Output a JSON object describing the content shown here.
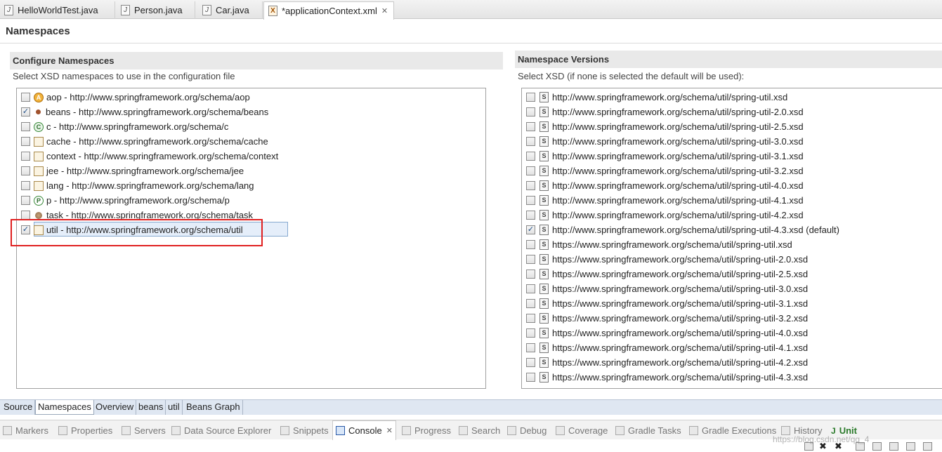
{
  "editor_tabs": [
    {
      "label": "HelloWorldTest.java",
      "icon": "java-file-icon"
    },
    {
      "label": "Person.java",
      "icon": "java-file-icon"
    },
    {
      "label": "Car.java",
      "icon": "java-file-icon"
    },
    {
      "label": "*applicationContext.xml",
      "icon": "xml-file-icon",
      "active": true
    }
  ],
  "page_title": "Namespaces",
  "configure": {
    "heading": "Configure Namespaces",
    "description": "Select XSD namespaces to use in the configuration file",
    "items": [
      {
        "label": "aop - http://www.springframework.org/schema/aop",
        "checked": false,
        "icon": "aop-icon"
      },
      {
        "label": "beans - http://www.springframework.org/schema/beans",
        "checked": true,
        "icon": "bean-icon"
      },
      {
        "label": "c - http://www.springframework.org/schema/c",
        "checked": false,
        "icon": "c-icon"
      },
      {
        "label": "cache - http://www.springframework.org/schema/cache",
        "checked": false,
        "icon": "namespace-doc-icon"
      },
      {
        "label": "context - http://www.springframework.org/schema/context",
        "checked": false,
        "icon": "namespace-doc-icon"
      },
      {
        "label": "jee - http://www.springframework.org/schema/jee",
        "checked": false,
        "icon": "namespace-doc-icon"
      },
      {
        "label": "lang - http://www.springframework.org/schema/lang",
        "checked": false,
        "icon": "namespace-doc-icon"
      },
      {
        "label": "p - http://www.springframework.org/schema/p",
        "checked": false,
        "icon": "p-icon"
      },
      {
        "label": "task - http://www.springframework.org/schema/task",
        "checked": false,
        "icon": "task-icon"
      },
      {
        "label": "util - http://www.springframework.org/schema/util",
        "checked": true,
        "icon": "namespace-doc-icon",
        "selected": true
      }
    ]
  },
  "versions": {
    "heading": "Namespace Versions",
    "description": "Select XSD (if none is selected the default will be used):",
    "items": [
      {
        "label": "http://www.springframework.org/schema/util/spring-util.xsd",
        "checked": false
      },
      {
        "label": "http://www.springframework.org/schema/util/spring-util-2.0.xsd",
        "checked": false
      },
      {
        "label": "http://www.springframework.org/schema/util/spring-util-2.5.xsd",
        "checked": false
      },
      {
        "label": "http://www.springframework.org/schema/util/spring-util-3.0.xsd",
        "checked": false
      },
      {
        "label": "http://www.springframework.org/schema/util/spring-util-3.1.xsd",
        "checked": false
      },
      {
        "label": "http://www.springframework.org/schema/util/spring-util-3.2.xsd",
        "checked": false
      },
      {
        "label": "http://www.springframework.org/schema/util/spring-util-4.0.xsd",
        "checked": false
      },
      {
        "label": "http://www.springframework.org/schema/util/spring-util-4.1.xsd",
        "checked": false
      },
      {
        "label": "http://www.springframework.org/schema/util/spring-util-4.2.xsd",
        "checked": false
      },
      {
        "label": "http://www.springframework.org/schema/util/spring-util-4.3.xsd (default)",
        "checked": true
      },
      {
        "label": "https://www.springframework.org/schema/util/spring-util.xsd",
        "checked": false
      },
      {
        "label": "https://www.springframework.org/schema/util/spring-util-2.0.xsd",
        "checked": false
      },
      {
        "label": "https://www.springframework.org/schema/util/spring-util-2.5.xsd",
        "checked": false
      },
      {
        "label": "https://www.springframework.org/schema/util/spring-util-3.0.xsd",
        "checked": false
      },
      {
        "label": "https://www.springframework.org/schema/util/spring-util-3.1.xsd",
        "checked": false
      },
      {
        "label": "https://www.springframework.org/schema/util/spring-util-3.2.xsd",
        "checked": false
      },
      {
        "label": "https://www.springframework.org/schema/util/spring-util-4.0.xsd",
        "checked": false
      },
      {
        "label": "https://www.springframework.org/schema/util/spring-util-4.1.xsd",
        "checked": false
      },
      {
        "label": "https://www.springframework.org/schema/util/spring-util-4.2.xsd",
        "checked": false
      },
      {
        "label": "https://www.springframework.org/schema/util/spring-util-4.3.xsd",
        "checked": false
      }
    ]
  },
  "bottom_tabs": [
    "Source",
    "Namespaces",
    "Overview",
    "beans",
    "util",
    "Beans Graph"
  ],
  "active_bottom_tab": "Namespaces",
  "views": [
    {
      "label": "Markers"
    },
    {
      "label": "Properties"
    },
    {
      "label": "Servers"
    },
    {
      "label": "Data Source Explorer"
    },
    {
      "label": "Snippets"
    },
    {
      "label": "Console",
      "active": true
    },
    {
      "label": "Progress"
    },
    {
      "label": "Search"
    },
    {
      "label": "Debug"
    },
    {
      "label": "Coverage"
    },
    {
      "label": "Gradle Tasks"
    },
    {
      "label": "Gradle Executions"
    },
    {
      "label": "History"
    },
    {
      "label": "JUnit"
    }
  ],
  "watermark": "https://blog.csdn.net/qq_4"
}
